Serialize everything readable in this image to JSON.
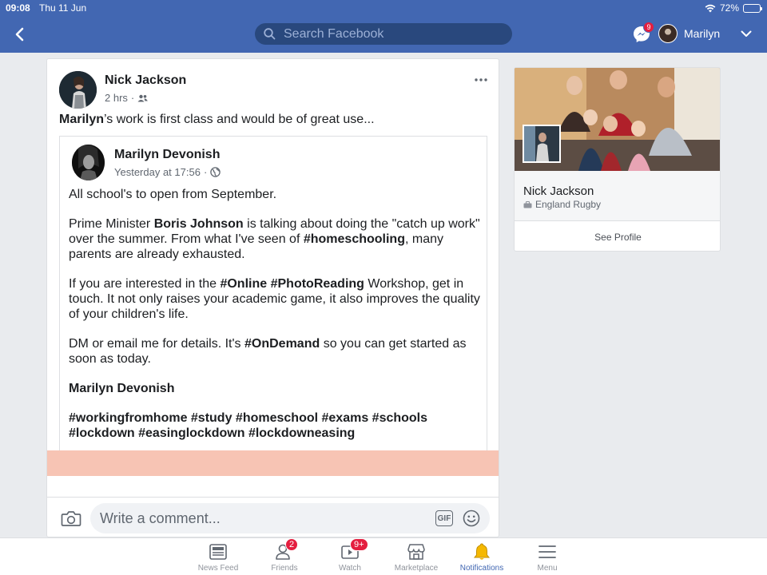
{
  "status_bar": {
    "time": "09:08",
    "date": "Thu 11 Jun",
    "battery": "72%",
    "battery_level": 0.72
  },
  "header": {
    "search_placeholder": "Search Facebook",
    "messenger_badge": "9",
    "user_name": "Marilyn"
  },
  "post": {
    "author": "Nick Jackson",
    "meta": "2 hrs",
    "text_bold": "Marilyn",
    "text_rest": "’s work is first class and would be of great use...",
    "shared": {
      "author": "Marilyn Devonish",
      "meta": "Yesterday at 17:56",
      "p1": "All school's to open from September.",
      "p2_a": "Prime Minister ",
      "p2_b": "Boris Johnson",
      "p2_c": " is talking about doing the \"catch up work\" over the summer.  From what I've seen of ",
      "p2_d": "#homeschooling",
      "p2_e": ", many parents are already exhausted.",
      "p3_a": "If you are interested in the ",
      "p3_b": "#Online",
      "p3_c": " ",
      "p3_d": "#PhotoReading",
      "p3_e": " Workshop, get in touch. It not only raises your academic game, it also improves the quality of your children's life.",
      "p4_a": "DM or email me for details. It's ",
      "p4_b": "#OnDemand",
      "p4_c": " so you can get started as soon as today.",
      "p5": "Marilyn Devonish",
      "p6": "#workingfromhome #study #homeschool #exams #schools #lockdown #easinglockdown #lockdowneasing"
    },
    "comment_placeholder": "Write a comment...",
    "gif_label": "GIF"
  },
  "profile_card": {
    "name": "Nick Jackson",
    "subtitle": "England Rugby",
    "see_profile": "See Profile"
  },
  "tabs": [
    {
      "label": "News Feed",
      "icon": "news-feed-icon",
      "badge": ""
    },
    {
      "label": "Friends",
      "icon": "friends-icon",
      "badge": "2"
    },
    {
      "label": "Watch",
      "icon": "watch-icon",
      "badge": "9+"
    },
    {
      "label": "Marketplace",
      "icon": "marketplace-icon",
      "badge": ""
    },
    {
      "label": "Notifications",
      "icon": "bell-icon",
      "badge": "",
      "active": true
    },
    {
      "label": "Menu",
      "icon": "menu-icon",
      "badge": ""
    }
  ],
  "colors": {
    "brand": "#4267b2",
    "badge": "#e41e3f",
    "active_tab": "#4267b2",
    "bell": "#f5b800"
  }
}
